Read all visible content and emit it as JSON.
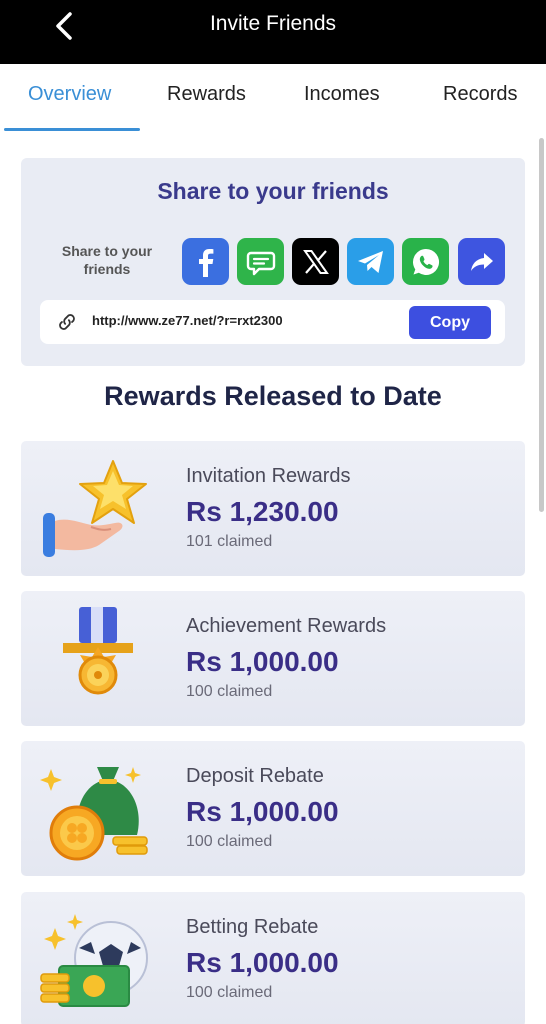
{
  "header": {
    "title": "Invite Friends",
    "back_icon": "chevron-left-icon"
  },
  "tabs": [
    {
      "label": "Overview",
      "active": true
    },
    {
      "label": "Rewards",
      "active": false
    },
    {
      "label": "Incomes",
      "active": false
    },
    {
      "label": "Records",
      "active": false
    }
  ],
  "share": {
    "title": "Share to your friends",
    "label_line1": "Share to your",
    "label_line2": "friends",
    "platforms": [
      {
        "name": "facebook-icon",
        "color": "#3b6fe0"
      },
      {
        "name": "message-icon",
        "color": "#2fb44a"
      },
      {
        "name": "x-icon",
        "color": "#000000"
      },
      {
        "name": "telegram-icon",
        "color": "#2a9ee8"
      },
      {
        "name": "whatsapp-icon",
        "color": "#29b34a"
      },
      {
        "name": "share-forward-icon",
        "color": "#3e55e0"
      }
    ],
    "link_url": "http://www.ze77.net/?r=rxt2300",
    "copy_label": "Copy"
  },
  "rewards_section": {
    "title": "Rewards Released to Date",
    "items": [
      {
        "name": "Invitation Rewards",
        "currency": "Rs",
        "amount": "1,230.00",
        "claimed": "101 claimed"
      },
      {
        "name": "Achievement Rewards",
        "currency": "Rs",
        "amount": "1,000.00",
        "claimed": "100 claimed"
      },
      {
        "name": "Deposit Rebate",
        "currency": "Rs",
        "amount": "1,000.00",
        "claimed": "100 claimed"
      },
      {
        "name": "Betting Rebate",
        "currency": "Rs",
        "amount": "1,000.00",
        "claimed": "100 claimed"
      }
    ]
  },
  "colors": {
    "accent": "#3a8fd6",
    "primary_text": "#3a2e87",
    "copy_button": "#3d4fe0"
  }
}
